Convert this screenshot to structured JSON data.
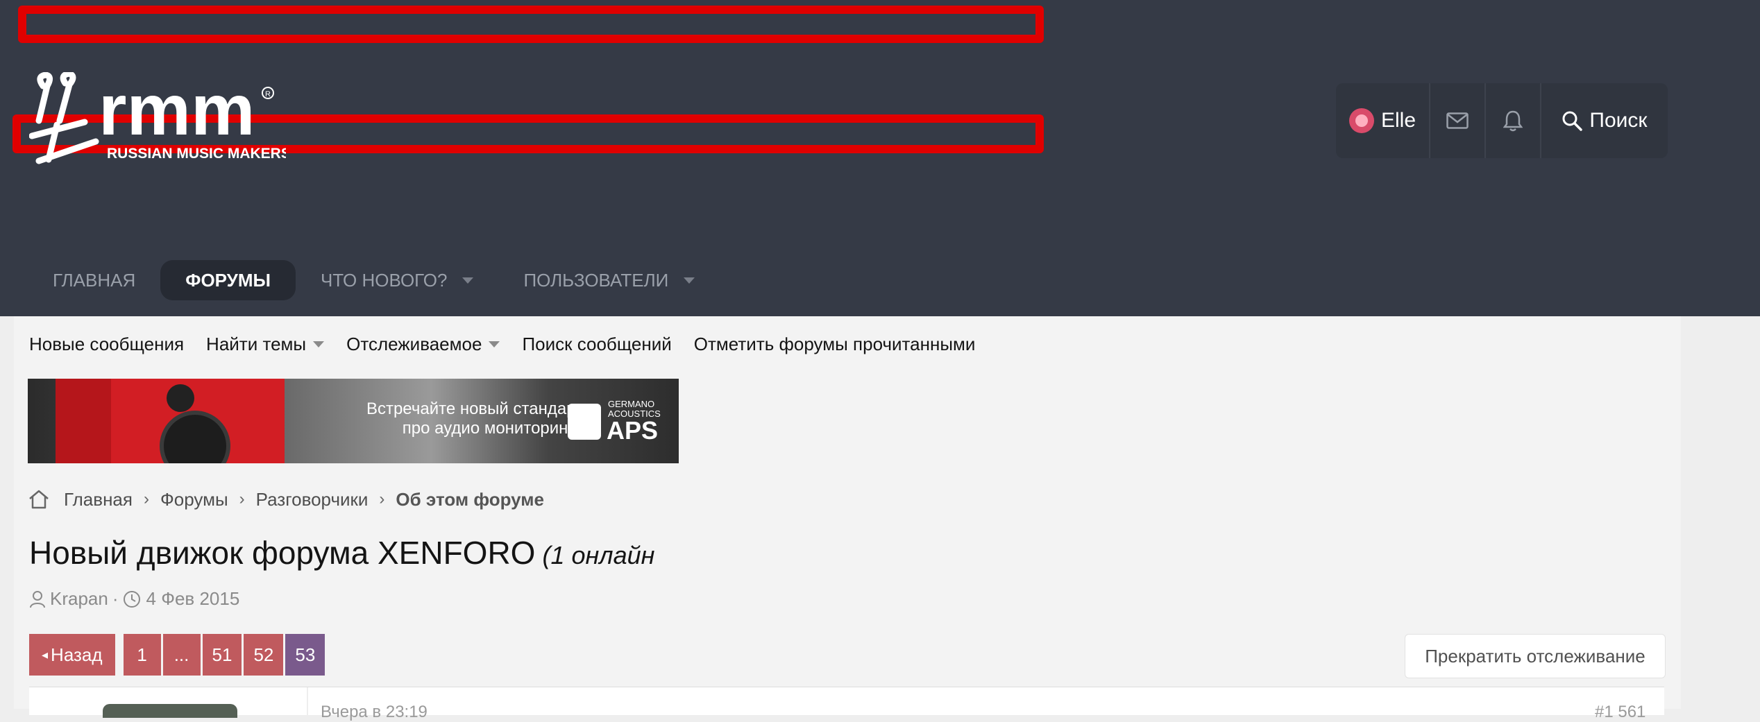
{
  "colors": {
    "header_bg": "#353a46",
    "accent_red": "#e00000",
    "pager_bg": "#c05a5e",
    "pager_current": "#7a5a8c",
    "content_bg": "#f3f3f3"
  },
  "logo": {
    "tagline": "RUSSIAN MUSIC MAKERS",
    "wordmark": "rmm",
    "icon": "rmm-logo"
  },
  "user_nav": {
    "username": "Elle",
    "search_label": "Поиск",
    "icons": [
      "avatar",
      "envelope-icon",
      "bell-icon",
      "search-icon"
    ]
  },
  "nav_tabs": [
    {
      "label": "ГЛАВНАЯ",
      "active": false,
      "has_dropdown": false
    },
    {
      "label": "ФОРУМЫ",
      "active": true,
      "has_dropdown": false
    },
    {
      "label": "ЧТО НОВОГО?",
      "active": false,
      "has_dropdown": true
    },
    {
      "label": "ПОЛЬЗОВАТЕЛИ",
      "active": false,
      "has_dropdown": true
    }
  ],
  "sub_nav": [
    {
      "label": "Новые сообщения",
      "has_dropdown": false
    },
    {
      "label": "Найти темы",
      "has_dropdown": true
    },
    {
      "label": "Отслеживаемое",
      "has_dropdown": true
    },
    {
      "label": "Поиск сообщений",
      "has_dropdown": false
    },
    {
      "label": "Отметить форумы прочитанными",
      "has_dropdown": false
    }
  ],
  "banner": {
    "line1": "Встречайте новый стандарт",
    "line2": "про аудио мониторинга",
    "brand_line1": "GERMANO",
    "brand_line2": "ACOUSTICS",
    "brand_big": "APS"
  },
  "breadcrumbs": [
    "Главная",
    "Форумы",
    "Разговорчики",
    "Об этом форуме"
  ],
  "thread": {
    "title": "Новый движок форума XENFORO",
    "online": "(1 онлайн",
    "author": "Krapan",
    "date": "4 Фев 2015",
    "separator": "·"
  },
  "pagination": {
    "prev_label": "Назад",
    "pages": [
      "1",
      "...",
      "51",
      "52",
      "53"
    ],
    "current": "53"
  },
  "watch_button": "Прекратить отслеживание",
  "post_preview": {
    "date": "Вчера в 23:19",
    "number": "#1 561"
  }
}
